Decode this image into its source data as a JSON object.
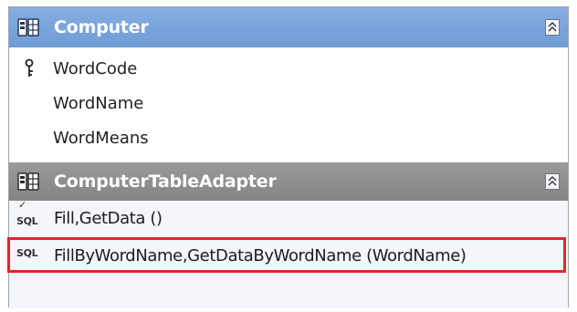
{
  "table": {
    "title": "Computer",
    "icon": "table-icon",
    "collapse_icon": "double-chevron-up-icon",
    "columns": [
      {
        "name": "WordCode",
        "is_key": true
      },
      {
        "name": "WordName",
        "is_key": false
      },
      {
        "name": "WordMeans",
        "is_key": false
      }
    ]
  },
  "adapter": {
    "title": "ComputerTableAdapter",
    "icon": "table-adapter-icon",
    "collapse_icon": "double-chevron-up-icon",
    "queries": [
      {
        "name": "Fill,GetData ()",
        "icon_label": "SQL",
        "checked": true,
        "highlighted": false
      },
      {
        "name": "FillByWordName,GetDataByWordName (WordName)",
        "icon_label": "SQL",
        "checked": false,
        "highlighted": true
      }
    ]
  },
  "colors": {
    "table_header": "#7aa6dd",
    "adapter_header": "#8e8e8e",
    "highlight_border": "#e0262e"
  }
}
